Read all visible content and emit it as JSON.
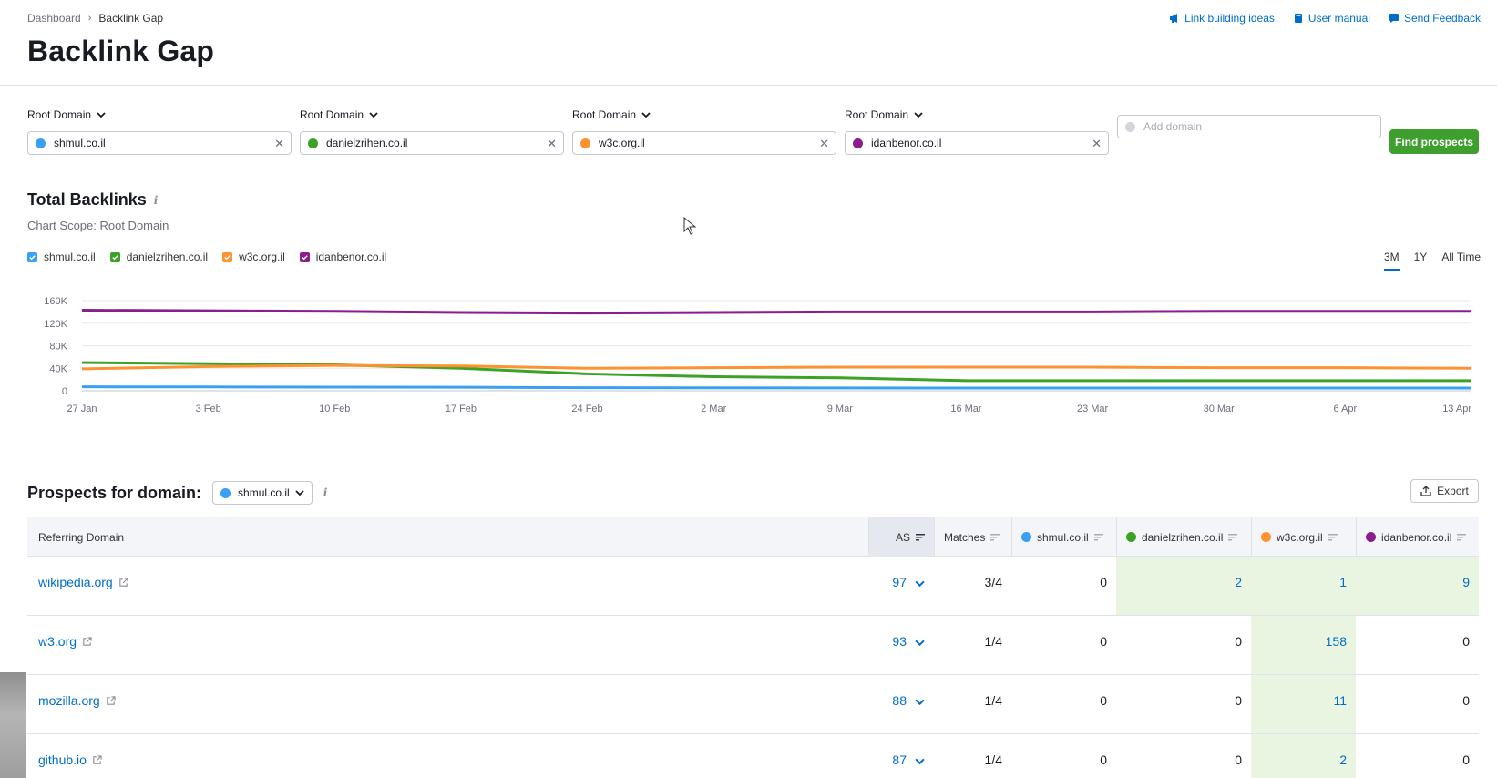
{
  "breadcrumb": {
    "root": "Dashboard",
    "current": "Backlink Gap"
  },
  "top_links": [
    {
      "label": "Link building ideas",
      "icon": "megaphone-icon"
    },
    {
      "label": "User manual",
      "icon": "book-icon"
    },
    {
      "label": "Send Feedback",
      "icon": "chat-icon"
    }
  ],
  "page_title": "Backlink Gap",
  "domains": [
    {
      "scope": "Root Domain",
      "value": "shmul.co.il",
      "color": "#3aa0f3"
    },
    {
      "scope": "Root Domain",
      "value": "danielzrihen.co.il",
      "color": "#3ca226"
    },
    {
      "scope": "Root Domain",
      "value": "w3c.org.il",
      "color": "#fd9330"
    },
    {
      "scope": "Root Domain",
      "value": "idanbenor.co.il",
      "color": "#8a1e8c"
    }
  ],
  "add_domain_placeholder": "Add domain",
  "find_button": "Find prospects",
  "total_backlinks": {
    "title": "Total Backlinks",
    "scope": "Chart Scope: Root Domain"
  },
  "range_tabs": [
    "3M",
    "1Y",
    "All Time"
  ],
  "active_range": "3M",
  "chart_data": {
    "type": "line",
    "title": "Total Backlinks",
    "x": [
      "27 Jan",
      "3 Feb",
      "10 Feb",
      "17 Feb",
      "24 Feb",
      "2 Mar",
      "9 Mar",
      "16 Mar",
      "23 Mar",
      "30 Mar",
      "6 Apr",
      "13 Apr"
    ],
    "y_ticks": [
      "0",
      "40K",
      "80K",
      "120K",
      "160K"
    ],
    "ylim": [
      0,
      160000
    ],
    "grid": true,
    "series": [
      {
        "name": "shmul.co.il",
        "color": "#3aa0f3",
        "values": [
          7000,
          6800,
          6500,
          6300,
          5500,
          5200,
          5000,
          4900,
          4900,
          4800,
          4800,
          4800
        ]
      },
      {
        "name": "danielzrihen.co.il",
        "color": "#3ca226",
        "values": [
          50000,
          48000,
          46000,
          40000,
          30000,
          25000,
          23000,
          18000,
          18000,
          18000,
          18000,
          18000
        ]
      },
      {
        "name": "w3c.org.il",
        "color": "#fd9330",
        "values": [
          39000,
          43000,
          45000,
          44000,
          40000,
          41000,
          42000,
          42000,
          42000,
          41000,
          41000,
          40000
        ]
      },
      {
        "name": "idanbenor.co.il",
        "color": "#8a1e8c",
        "values": [
          143000,
          142000,
          141000,
          139000,
          138000,
          139000,
          140000,
          140000,
          140000,
          141000,
          141000,
          141000
        ]
      }
    ]
  },
  "prospects": {
    "title": "Prospects for domain:",
    "selected_domain": "shmul.co.il",
    "export_label": "Export",
    "columns": [
      "Referring Domain",
      "AS",
      "Matches",
      "shmul.co.il",
      "danielzrihen.co.il",
      "w3c.org.il",
      "idanbenor.co.il"
    ],
    "rows": [
      {
        "domain": "wikipedia.org",
        "as": "97",
        "matches": "3/4",
        "values": [
          "0",
          "2",
          "1",
          "9"
        ],
        "highlight": [
          false,
          true,
          true,
          true
        ]
      },
      {
        "domain": "w3.org",
        "as": "93",
        "matches": "1/4",
        "values": [
          "0",
          "0",
          "158",
          "0"
        ],
        "highlight": [
          false,
          false,
          true,
          false
        ]
      },
      {
        "domain": "mozilla.org",
        "as": "88",
        "matches": "1/4",
        "values": [
          "0",
          "0",
          "11",
          "0"
        ],
        "highlight": [
          false,
          false,
          true,
          false
        ]
      },
      {
        "domain": "github.io",
        "as": "87",
        "matches": "1/4",
        "values": [
          "0",
          "0",
          "2",
          "0"
        ],
        "highlight": [
          false,
          false,
          true,
          false
        ]
      }
    ]
  }
}
